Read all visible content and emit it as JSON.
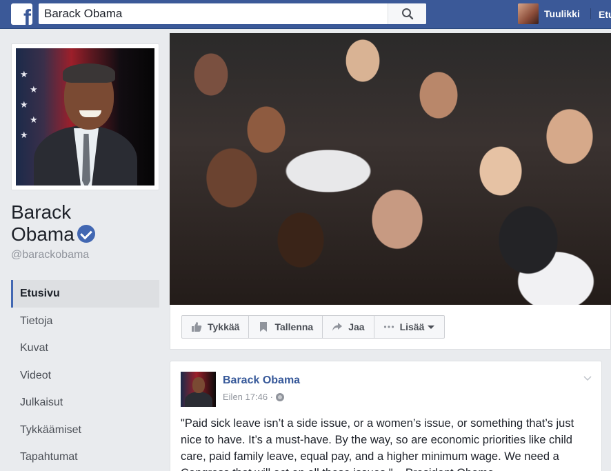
{
  "topbar": {
    "logo": "f",
    "search_value": "Barack Obama",
    "user_name": "Tuulikki",
    "home_label": "Etusivu"
  },
  "profile": {
    "name_line1": "Barack",
    "name_line2": "Obama",
    "handle": "@barackobama"
  },
  "nav": {
    "items": [
      {
        "label": "Etusivu",
        "active": true
      },
      {
        "label": "Tietoja"
      },
      {
        "label": "Kuvat"
      },
      {
        "label": "Videot"
      },
      {
        "label": "Julkaisut"
      },
      {
        "label": "Tykkäämiset"
      },
      {
        "label": "Tapahtumat"
      }
    ]
  },
  "actions": {
    "like": "Tykkää",
    "save": "Tallenna",
    "share": "Jaa",
    "more": "Lisää"
  },
  "post": {
    "author": "Barack Obama",
    "time": "Eilen 17:46 ·",
    "text": "\"Paid sick leave isn’t a side issue, or a women’s issue, or something that’s just nice to have. It’s a must-have. By the way, so are economic priorities like child care, paid family leave, equal pay, and a higher minimum wage. We need a Congress that will act on all these issues.\" – President Obama"
  },
  "colors": {
    "brand": "#3b5998",
    "link": "#365899",
    "verified": "#4267b2"
  }
}
